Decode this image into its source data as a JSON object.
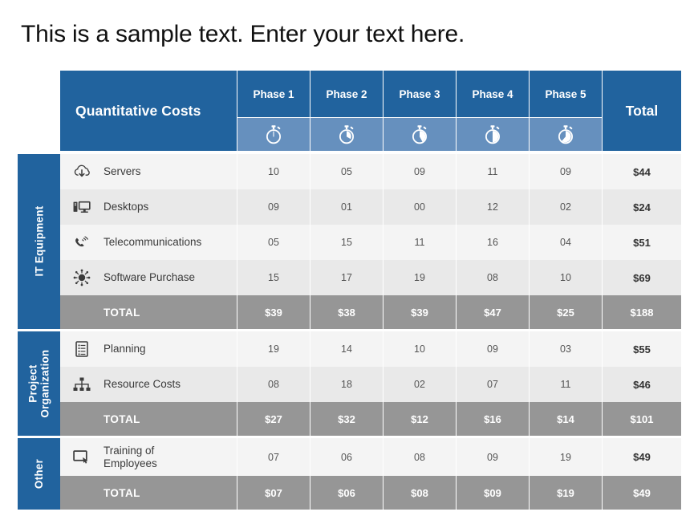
{
  "title": "This is a sample text. Enter your text here.",
  "colors": {
    "header_blue": "#21639E",
    "icon_row_blue": "#6690BE",
    "total_gray": "#969696",
    "row_light": "#F4F4F4",
    "row_dark": "#E9E9E9"
  },
  "table": {
    "corner_title": "Quantitative Costs",
    "total_column_label": "Total",
    "phase_columns": [
      {
        "label": "Phase 1",
        "icon": "stopwatch-icon",
        "fill_percent": 0
      },
      {
        "label": "Phase 2",
        "icon": "stopwatch-icon",
        "fill_percent": 25
      },
      {
        "label": "Phase 3",
        "icon": "stopwatch-icon",
        "fill_percent": 40
      },
      {
        "label": "Phase 4",
        "icon": "stopwatch-icon",
        "fill_percent": 50
      },
      {
        "label": "Phase 5",
        "icon": "stopwatch-icon",
        "fill_percent": 65
      }
    ],
    "total_row_label": "TOTAL",
    "groups": [
      {
        "name": "IT Equipment",
        "rows": [
          {
            "icon": "cloud-download-icon",
            "label": "Servers",
            "values": [
              "10",
              "05",
              "09",
              "11",
              "09"
            ],
            "total": "$44"
          },
          {
            "icon": "desktop-computer-icon",
            "label": "Desktops",
            "values": [
              "09",
              "01",
              "00",
              "12",
              "02"
            ],
            "total": "$24"
          },
          {
            "icon": "telephone-icon",
            "label": "Telecommunications",
            "values": [
              "05",
              "15",
              "11",
              "16",
              "04"
            ],
            "total": "$51"
          },
          {
            "icon": "software-hub-icon",
            "label": "Software Purchase",
            "values": [
              "15",
              "17",
              "19",
              "08",
              "10"
            ],
            "total": "$69"
          }
        ],
        "totals": {
          "label": "TOTAL",
          "values": [
            "$39",
            "$38",
            "$39",
            "$47",
            "$25"
          ],
          "total": "$188"
        }
      },
      {
        "name": "Project\nOrganization",
        "rows": [
          {
            "icon": "clipboard-list-icon",
            "label": "Planning",
            "values": [
              "19",
              "14",
              "10",
              "09",
              "03"
            ],
            "total": "$55"
          },
          {
            "icon": "org-chart-icon",
            "label": "Resource Costs",
            "values": [
              "08",
              "18",
              "02",
              "07",
              "11"
            ],
            "total": "$46"
          }
        ],
        "totals": {
          "label": "TOTAL",
          "values": [
            "$27",
            "$32",
            "$12",
            "$16",
            "$14"
          ],
          "total": "$101"
        }
      },
      {
        "name": "Other",
        "rows": [
          {
            "icon": "presentation-board-icon",
            "label": "Training of\nEmployees",
            "values": [
              "07",
              "06",
              "08",
              "09",
              "19"
            ],
            "total": "$49"
          }
        ],
        "totals": {
          "label": "TOTAL",
          "values": [
            "$07",
            "$06",
            "$08",
            "$09",
            "$19"
          ],
          "total": "$49"
        }
      }
    ]
  }
}
